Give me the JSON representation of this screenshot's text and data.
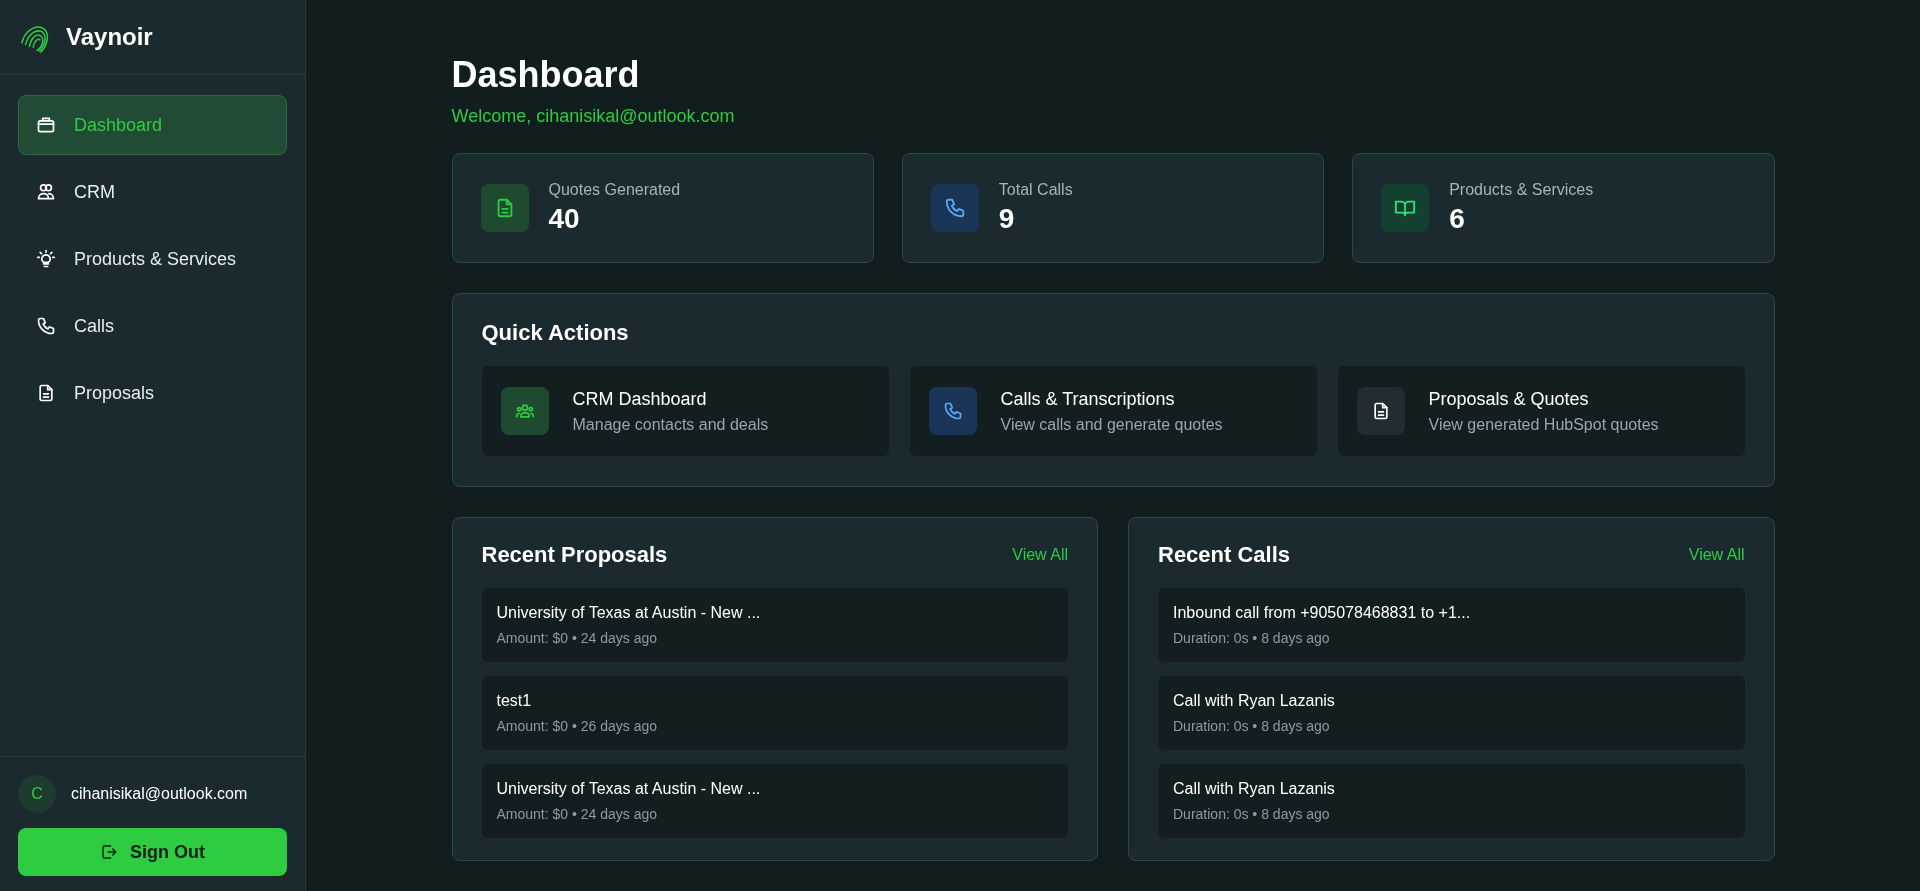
{
  "brand": {
    "name": "Vaynoir"
  },
  "sidebar": {
    "items": [
      {
        "label": "Dashboard",
        "selected": true
      },
      {
        "label": "CRM",
        "selected": false
      },
      {
        "label": "Products & Services",
        "selected": false
      },
      {
        "label": "Calls",
        "selected": false
      },
      {
        "label": "Proposals",
        "selected": false
      }
    ]
  },
  "user": {
    "initial": "C",
    "email": "cihanisikal@outlook.com"
  },
  "sign_out": {
    "label": "Sign Out"
  },
  "page": {
    "title": "Dashboard",
    "welcome": "Welcome, cihanisikal@outlook.com"
  },
  "stats": [
    {
      "label": "Quotes Generated",
      "value": "40"
    },
    {
      "label": "Total Calls",
      "value": "9"
    },
    {
      "label": "Products & Services",
      "value": "6"
    }
  ],
  "quick_actions": {
    "title": "Quick Actions",
    "items": [
      {
        "title": "CRM Dashboard",
        "description": "Manage contacts and deals"
      },
      {
        "title": "Calls & Transcriptions",
        "description": "View calls and generate quotes"
      },
      {
        "title": "Proposals & Quotes",
        "description": "View generated HubSpot quotes"
      }
    ]
  },
  "recent_proposals": {
    "title": "Recent Proposals",
    "link": "View All",
    "items": [
      {
        "title": "University of Texas at Austin - New ...",
        "meta": "Amount: $0 • 24 days ago"
      },
      {
        "title": "test1",
        "meta": "Amount: $0 • 26 days ago"
      },
      {
        "title": "University of Texas at Austin - New ...",
        "meta": "Amount: $0 • 24 days ago"
      }
    ]
  },
  "recent_calls": {
    "title": "Recent Calls",
    "link": "View All",
    "items": [
      {
        "title": "Inbound call from +905078468831 to +1...",
        "meta": "Duration: 0s • 8 days ago"
      },
      {
        "title": "Call with Ryan Lazanis",
        "meta": "Duration: 0s • 8 days ago"
      },
      {
        "title": "Call with Ryan Lazanis",
        "meta": "Duration: 0s • 8 days ago"
      }
    ]
  }
}
